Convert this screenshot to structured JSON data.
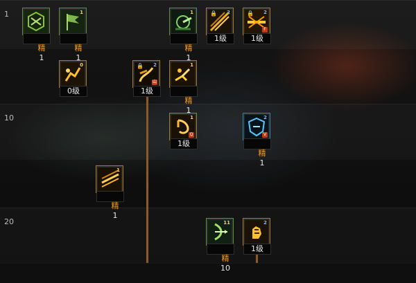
{
  "skill_tree": {
    "level_markers": [
      "1",
      "10",
      "20"
    ],
    "skills": [
      {
        "id": "s1",
        "label_prefix": "精",
        "label_value": "1",
        "badge": "",
        "theme": "green"
      },
      {
        "id": "s2",
        "label_prefix": "精",
        "label_value": "1",
        "badge": "1",
        "theme": "green"
      },
      {
        "id": "s3",
        "label_prefix": "精",
        "label_value": "1",
        "badge": "1",
        "theme": "green"
      },
      {
        "id": "s4",
        "label": "1级",
        "badge": "2",
        "theme": "orange",
        "locked": true
      },
      {
        "id": "s5",
        "label": "1级",
        "badge": "2",
        "theme": "orange",
        "locked": true,
        "corner": "F"
      },
      {
        "id": "s6",
        "label": "0级",
        "badge": "0",
        "theme": "orange"
      },
      {
        "id": "s7",
        "label": "1级",
        "badge": "2",
        "theme": "orange",
        "locked": true,
        "corner": "山"
      },
      {
        "id": "s8",
        "label_prefix": "精",
        "label_value": "1",
        "badge": "1",
        "theme": "orange"
      },
      {
        "id": "s9",
        "label": "1级",
        "badge": "1",
        "theme": "orange",
        "corner": "Q"
      },
      {
        "id": "s10",
        "label_prefix": "精",
        "label_value": "1",
        "badge": "2",
        "theme": "blue",
        "corner": "V"
      },
      {
        "id": "s11",
        "label_prefix": "精",
        "label_value": "1",
        "badge": "1",
        "theme": "orange"
      },
      {
        "id": "s12",
        "label_prefix": "精",
        "label_value": "10",
        "badge": "11",
        "theme": "green"
      },
      {
        "id": "s13",
        "label": "1级",
        "badge": "2",
        "theme": "orange"
      }
    ]
  }
}
